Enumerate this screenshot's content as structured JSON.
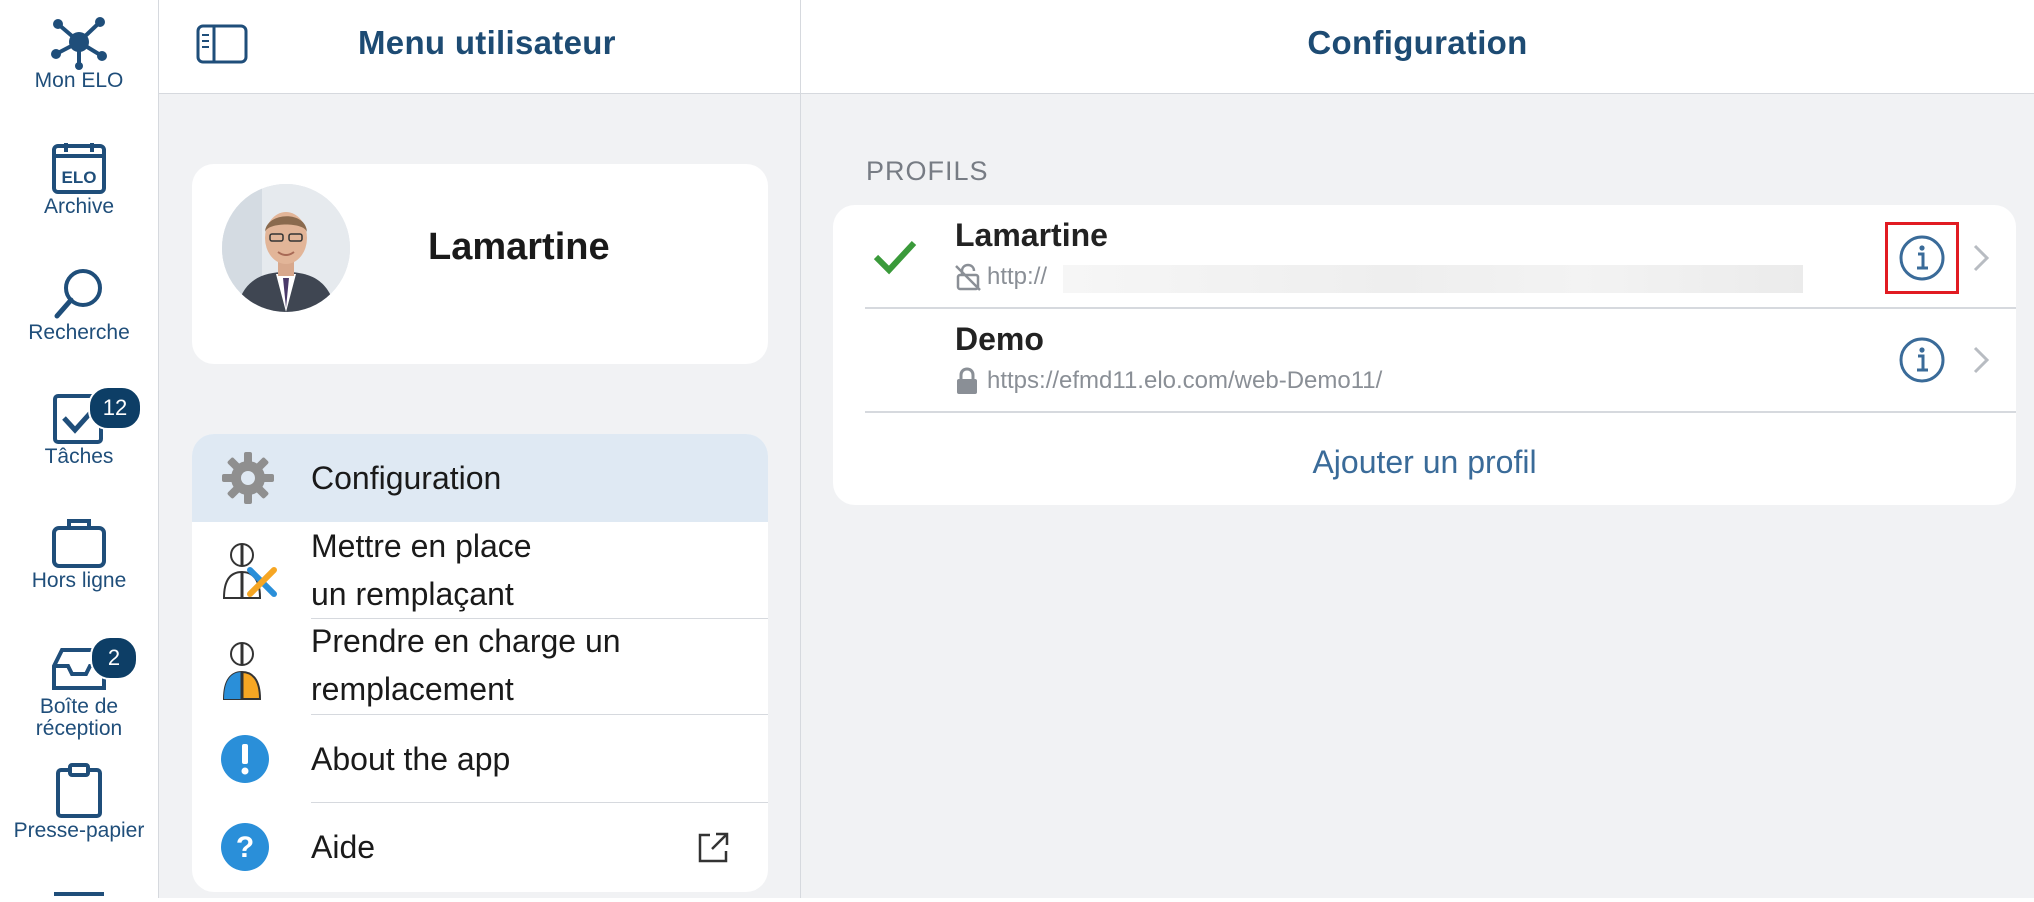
{
  "rail": {
    "items": [
      {
        "label": "Mon ELO",
        "icon": "network-hub-icon"
      },
      {
        "label": "Archive",
        "icon": "elo-archive-icon"
      },
      {
        "label": "Recherche",
        "icon": "search-icon"
      },
      {
        "label": "Tâches",
        "icon": "task-check-icon",
        "badge": "12"
      },
      {
        "label": "Hors ligne",
        "icon": "briefcase-icon"
      },
      {
        "label": "Boîte de réception",
        "icon": "inbox-tray-icon",
        "badge": "2"
      },
      {
        "label": "Presse-papier",
        "icon": "clipboard-icon"
      }
    ]
  },
  "header": {
    "left_title": "Menu utilisateur",
    "right_title": "Configuration",
    "sidebar_toggle_icon": "sidebar-toggle-icon"
  },
  "user": {
    "name": "Lamartine"
  },
  "menu": {
    "items": [
      {
        "label": "Configuration",
        "icon": "gear-icon",
        "selected": true
      },
      {
        "label_line1": "Mettre en place",
        "label_line2": "un remplaçant",
        "icon": "set-substitute-icon"
      },
      {
        "label_line1": "Prendre en charge un",
        "label_line2": "remplacement",
        "icon": "take-over-substitute-icon"
      },
      {
        "label": "About the app",
        "icon": "exclamation-circle-icon"
      },
      {
        "label": "Aide",
        "icon": "question-circle-icon",
        "trailing_icon": "external-link-icon"
      }
    ]
  },
  "profiles": {
    "heading": "PROFILS",
    "items": [
      {
        "name": "Lamartine",
        "url": "http://",
        "active": true,
        "lock_icon": "unlocked-slash-icon"
      },
      {
        "name": "Demo",
        "url": "https://efmd11.elo.com/web-Demo11/",
        "active": false,
        "lock_icon": "lock-icon"
      }
    ],
    "add_label": "Ajouter un profil"
  },
  "colors": {
    "accent": "#1d4b73",
    "link": "#3a6b99",
    "selected_row": "#dfe9f3",
    "badge": "#0d3e66",
    "check": "#3a9a3a",
    "highlight_box": "#e11b22"
  }
}
